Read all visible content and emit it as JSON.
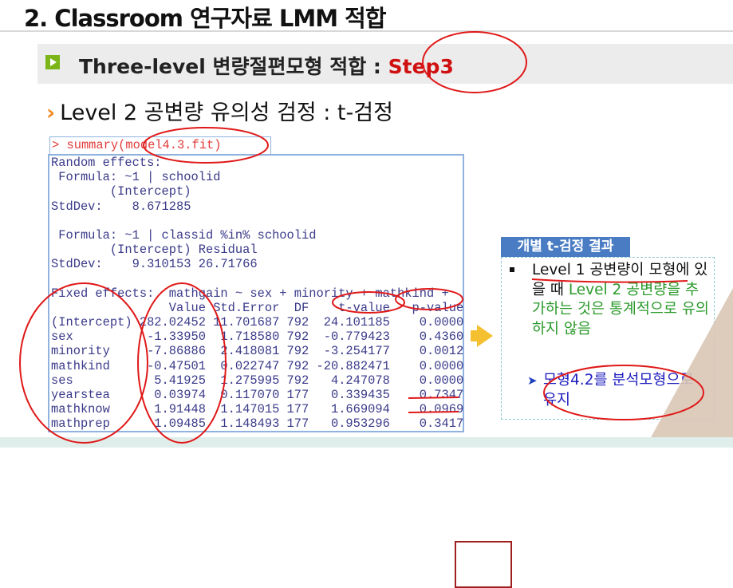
{
  "slide": {
    "title": "2. Classroom 연구자료 LMM 적합",
    "section_bar": {
      "text": "Three-level 변량절편모형 적합 : ",
      "step": "Step3"
    },
    "subheading": "Level 2 공변량 유의성 검정 : t-검정",
    "colors": {
      "accent_green": "#7cb518",
      "step_red": "#d01010",
      "panel_header": "#4a7cc4",
      "chevron": "#f08a24"
    }
  },
  "console": {
    "command": "> summary(model4.3.fit)",
    "random_effects_lines": [
      "Random effects:",
      " Formula: ~1 | schoolid",
      "        (Intercept)",
      "StdDev:    8.671285",
      "",
      " Formula: ~1 | classid %in% schoolid",
      "        (Intercept) Residual",
      "StdDev:    9.310153 26.71766",
      ""
    ],
    "fixed_header": "Fixed effects:  mathgain ~ sex + minority + mathkind +",
    "columns": [
      "Value",
      "Std.Error",
      "DF",
      "t-value",
      "p-value"
    ],
    "rows": [
      [
        "(Intercept)",
        "282.02452",
        "11.701687",
        "792",
        "24.101185",
        "0.0000"
      ],
      [
        "sex",
        "-1.33950",
        "1.718580",
        "792",
        "-0.779423",
        "0.4360"
      ],
      [
        "minority",
        "-7.86886",
        "2.418081",
        "792",
        "-3.254177",
        "0.0012"
      ],
      [
        "mathkind",
        "-0.47501",
        "0.022747",
        "792",
        "-20.882471",
        "0.0000"
      ],
      [
        "ses",
        "5.41925",
        "1.275995",
        "792",
        "4.247078",
        "0.0000"
      ],
      [
        "yearstea",
        "0.03974",
        "0.117070",
        "177",
        "0.339435",
        "0.7347"
      ],
      [
        "mathknow",
        "1.91448",
        "1.147015",
        "177",
        "1.669094",
        "0.0969"
      ],
      [
        "mathprep",
        "1.09485",
        "1.148493",
        "177",
        "0.953296",
        "0.3417"
      ]
    ]
  },
  "panel": {
    "header": "개별 t-검정 결과",
    "text_black": "Level 1 공변량이 모형에 있을 때 ",
    "text_green": "Level 2 공변량을 추가하는 것은 통계적으로 유의하지 않음",
    "conclusion": "모형4.2를 분석모형으로 유지"
  }
}
